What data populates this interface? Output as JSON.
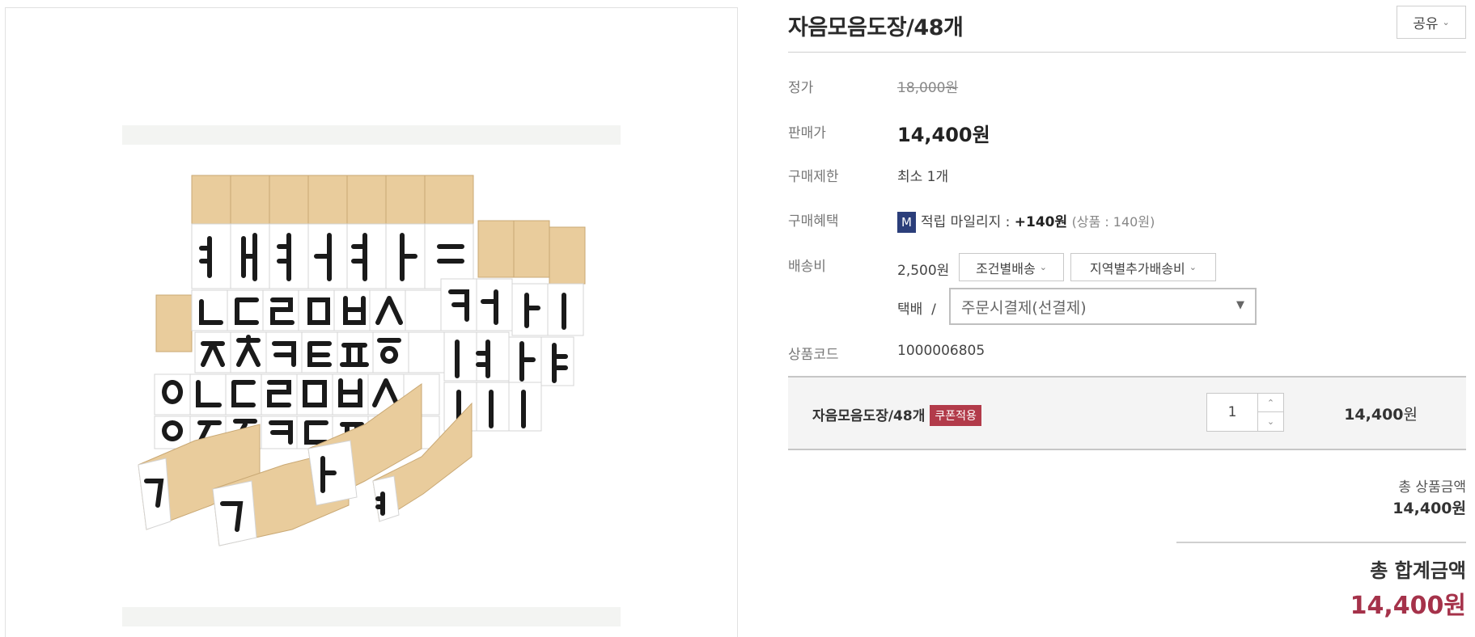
{
  "product": {
    "title": "자음모음도장/48개",
    "share_label": "공유"
  },
  "info": {
    "list_price_label": "정가",
    "list_price": "18,000원",
    "sale_price_label": "판매가",
    "sale_price": "14,400원",
    "limit_label": "구매제한",
    "limit_value": "최소 1개",
    "benefit_label": "구매혜택",
    "benefit_badge": "M",
    "benefit_text": "적립 마일리지 : ",
    "benefit_amount": "+140원",
    "benefit_detail": "(상품 : 140원)",
    "shipping_label": "배송비",
    "shipping_fee": "2,500원",
    "shipping_condition_btn": "조건별배송",
    "shipping_region_btn": "지역별추가배송비",
    "delivery_method": "택배",
    "delivery_sep": "/",
    "payment_select": "주문시결제(선결제)",
    "code_label": "상품코드",
    "code_value": "1000006805"
  },
  "cart": {
    "item_name": "자음모음도장/48개",
    "coupon_badge": "쿠폰적용",
    "quantity": "1",
    "price_number": "14,400",
    "price_unit": "원"
  },
  "totals": {
    "product_sum_label": "총 상품금액",
    "product_sum_value": "14,400원",
    "grand_total_label": "총 합계금액",
    "grand_total_value": "14,400원"
  },
  "icons": {
    "chevron": "chevron-down-icon",
    "select_arrow": "triangle-down-icon",
    "qty_up": "chevron-up-icon",
    "qty_down": "chevron-down-icon"
  },
  "colors": {
    "accent_price": "#a5324a",
    "coupon_badge": "#b23b4a",
    "mileage_badge": "#2b3e7a"
  }
}
